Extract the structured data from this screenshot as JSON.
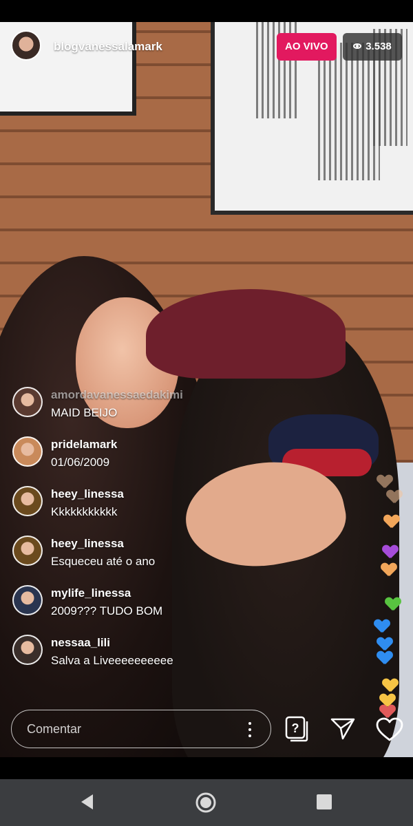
{
  "header": {
    "host_username": "blogvanessalamark",
    "live_label": "AO VIVO",
    "viewer_count": "3.538"
  },
  "comments": [
    {
      "username": "amordavanessaedakimi",
      "text": "MAID BEIJO",
      "avatar_color": "#5a3a30",
      "faded": true
    },
    {
      "username": "pridelamark",
      "text": "01/06/2009",
      "avatar_color": "#c98a5b",
      "faded": false
    },
    {
      "username": "heey_linessa",
      "text": "Kkkkkkkkkkk",
      "avatar_color": "#6b4a1e",
      "faded": false
    },
    {
      "username": "heey_linessa",
      "text": "Esqueceu até o ano",
      "avatar_color": "#6b4a1e",
      "faded": false
    },
    {
      "username": "mylife_linessa",
      "text": "2009??? TUDO BOM",
      "avatar_color": "#2a3550",
      "faded": false
    },
    {
      "username": "nessaa_lili",
      "text": "Salva a Liveeeeeeeeee",
      "avatar_color": "#3a2e2a",
      "faded": false
    }
  ],
  "composer": {
    "placeholder": "Comentar"
  },
  "reactions": [
    "#f5c49a",
    "#f5c49a",
    "#f2a65a",
    "#a64cd9",
    "#f2a65a",
    "#58c340",
    "#2f8df0",
    "#2f8df0",
    "#2f8df0",
    "#f6c445",
    "#f6c445",
    "#e05a5a"
  ]
}
